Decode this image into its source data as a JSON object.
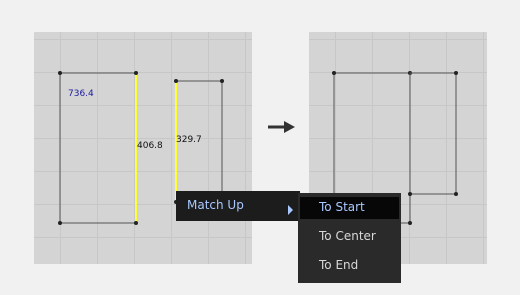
{
  "before": {
    "dimensions": {
      "width_label": "736.4",
      "height_left_label": "406.8",
      "height_right_label": "329.7"
    }
  },
  "arrow": {
    "icon": "right-arrow-icon"
  },
  "menu": {
    "match_up_label": "Match Up",
    "submenu_icon": "chevron-right-icon",
    "submenu": {
      "to_start_label": "To Start",
      "to_center_label": "To Center",
      "to_end_label": "To End"
    }
  },
  "colors": {
    "panel_bg": "#d4d4d4",
    "highlight_edge": "#ffff33",
    "width_label": "#1a1aa0",
    "menu_bg": "#1c1c1c",
    "menu_highlight_text": "#a9c8ff"
  }
}
